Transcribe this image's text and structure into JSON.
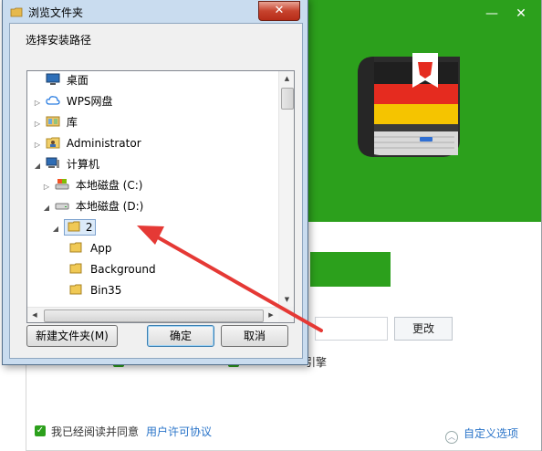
{
  "dialog": {
    "title": "浏览文件夹",
    "caption": "选择安装路径",
    "close_label": "✕",
    "tree": [
      {
        "label": "桌面",
        "icon": "desktop-icon",
        "arrow": ""
      },
      {
        "label": "WPS网盘",
        "icon": "cloud-icon",
        "arrow": "▷"
      },
      {
        "label": "库",
        "icon": "library-icon",
        "arrow": "▷"
      },
      {
        "label": "Administrator",
        "icon": "user-folder-icon",
        "arrow": "▷"
      },
      {
        "label": "计算机",
        "icon": "computer-icon",
        "arrow": "◢"
      },
      {
        "label": "本地磁盘 (C:)",
        "icon": "system-drive-icon",
        "arrow": "▷"
      },
      {
        "label": "本地磁盘 (D:)",
        "icon": "drive-icon",
        "arrow": "◢"
      },
      {
        "label": "2",
        "icon": "folder-open-icon",
        "arrow": "◢",
        "selected": true
      },
      {
        "label": "App",
        "icon": "folder-icon",
        "arrow": ""
      },
      {
        "label": "Background",
        "icon": "folder-icon",
        "arrow": ""
      },
      {
        "label": "Bin35",
        "icon": "folder-icon",
        "arrow": ""
      }
    ],
    "buttons": {
      "new_folder": "新建文件夹(M)",
      "ok": "确定",
      "cancel": "取消"
    }
  },
  "installer": {
    "window_controls": [
      "—",
      "✕"
    ],
    "change_button": "更改",
    "option_text": "引擎",
    "agree_text": "我已经阅读并同意",
    "license_link": "用户许可协议",
    "custom_options": "自定义选项"
  },
  "colors": {
    "brand_green": "#2ca01c",
    "link_blue": "#2a74c9",
    "annotation_arrow": "#e53935"
  }
}
